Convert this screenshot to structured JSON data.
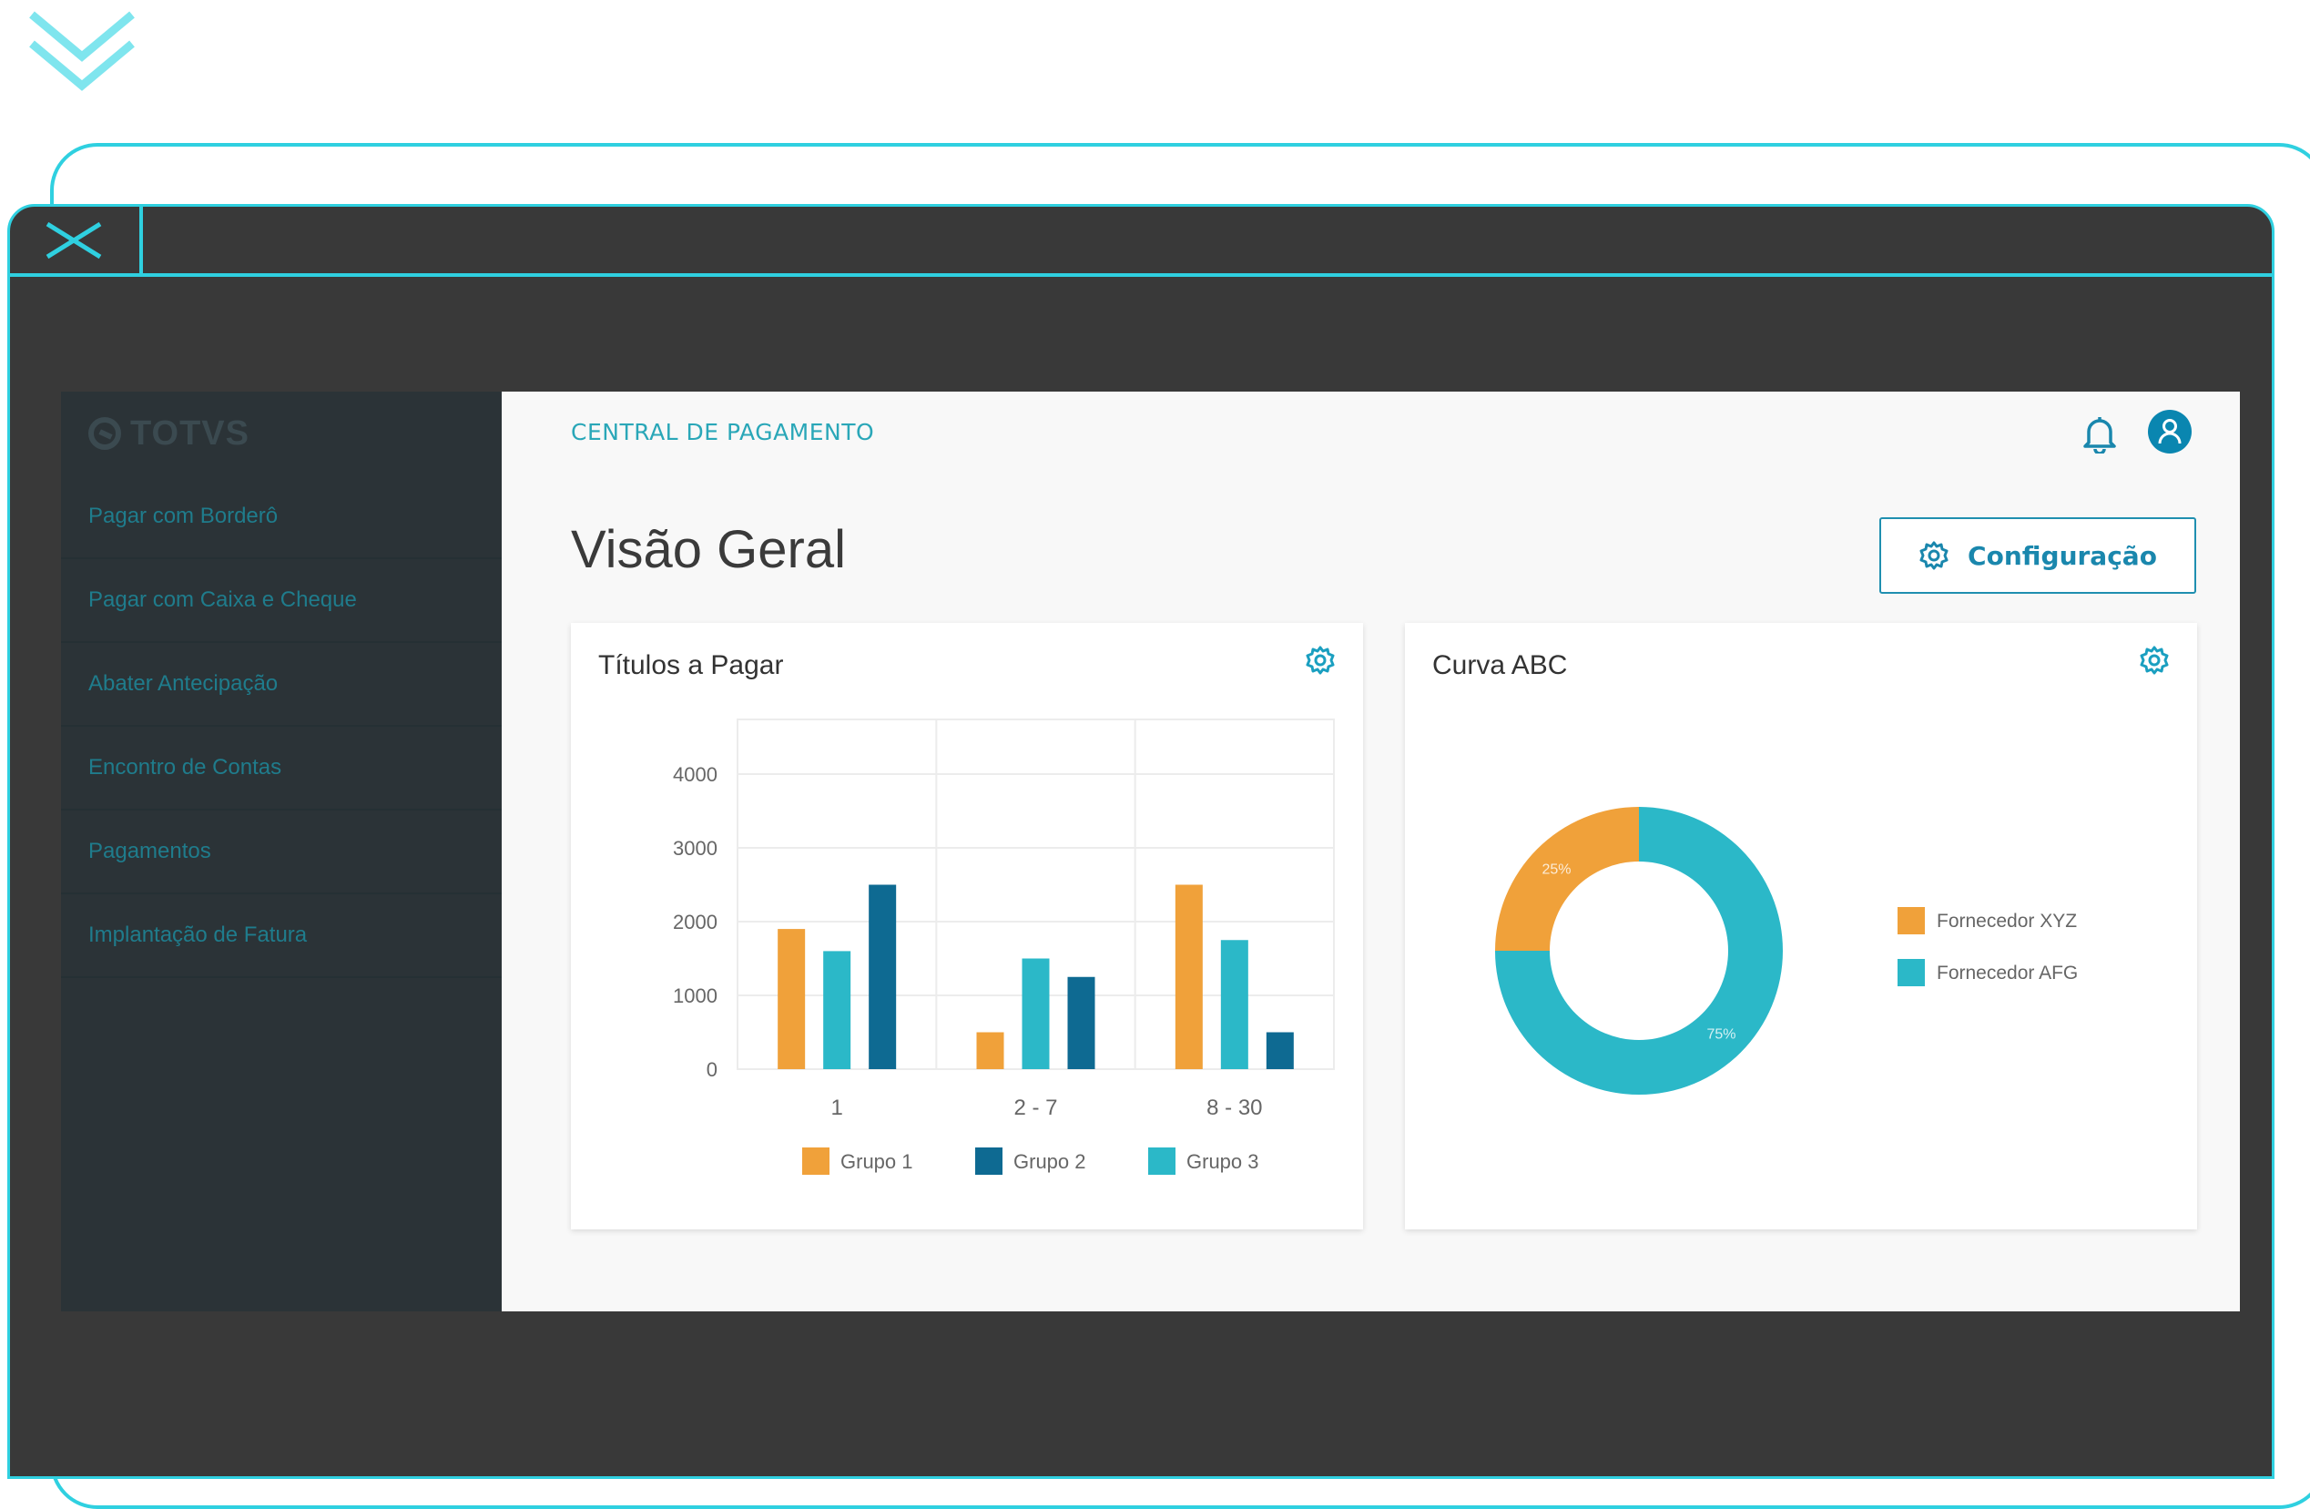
{
  "app": {
    "logo_text": "TOTVS",
    "header_title": "CENTRAL DE PAGAMENTO",
    "page_title": "Visão Geral",
    "config_label": "Configuração"
  },
  "sidebar": {
    "items": [
      {
        "label": "Pagar com Borderô"
      },
      {
        "label": "Pagar com Caixa e Cheque"
      },
      {
        "label": "Abater Antecipação"
      },
      {
        "label": "Encontro de Contas"
      },
      {
        "label": "Pagamentos"
      },
      {
        "label": "Implantação de Fatura"
      }
    ]
  },
  "cards": {
    "titulos_title": "Títulos a Pagar",
    "curva_title": "Curva ABC"
  },
  "icons": {
    "chevron": "double-chevron-down-icon",
    "close": "close-icon",
    "bell": "bell-icon",
    "user": "user-icon",
    "gear": "gear-icon"
  },
  "colors": {
    "accent": "#2fd0e0",
    "grupo1": "#f0a13a",
    "grupo2": "#0e6a92",
    "grupo3": "#2bb8c8",
    "brand_blue": "#1a87ad"
  },
  "chart_data": [
    {
      "type": "bar",
      "title": "Títulos a Pagar",
      "categories": [
        "1",
        "2 - 7",
        "8 - 30"
      ],
      "series": [
        {
          "name": "Grupo 1",
          "values": [
            1900,
            500,
            2500
          ]
        },
        {
          "name": "Grupo 3",
          "values": [
            1600,
            1500,
            1750
          ]
        },
        {
          "name": "Grupo 2",
          "values": [
            2500,
            1250,
            500
          ]
        }
      ],
      "yticks": [
        "4000",
        "3000",
        "2000",
        "1000",
        "0"
      ],
      "ylim": [
        0,
        4000
      ],
      "legend": [
        {
          "name": "Grupo 1",
          "color": "#f0a13a"
        },
        {
          "name": "Grupo 2",
          "color": "#0e6a92"
        },
        {
          "name": "Grupo 3",
          "color": "#2bb8c8"
        }
      ],
      "legend_position": "bottom",
      "grid": true
    },
    {
      "type": "pie",
      "title": "Curva ABC",
      "slices": [
        {
          "name": "Fornecedor XYZ",
          "value": 25,
          "label": "25%",
          "color": "#f0a13a"
        },
        {
          "name": "Fornecedor AFG",
          "value": 75,
          "label": "75%",
          "color": "#2bb8c8"
        }
      ],
      "legend_position": "right"
    }
  ]
}
